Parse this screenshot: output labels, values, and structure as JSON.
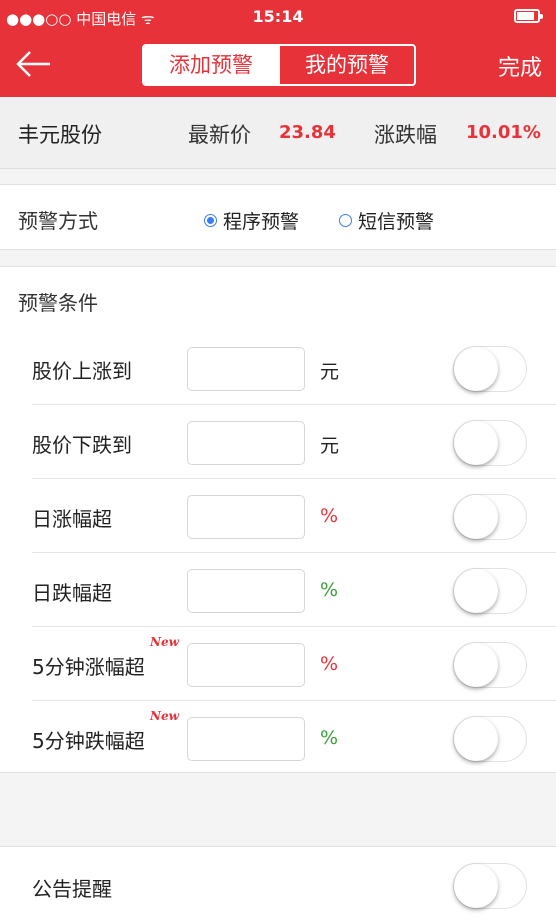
{
  "status_bar": {
    "carrier": "●●●○○ 中国电信 ᯤ",
    "time": "15:14",
    "battery_level": 0.85
  },
  "nav": {
    "back_icon": "arrow-left-icon",
    "tabs": [
      {
        "label": "添加预警",
        "active": true
      },
      {
        "label": "我的预警",
        "active": false
      }
    ],
    "done_label": "完成"
  },
  "stock": {
    "name": "丰元股份",
    "price_label": "最新价",
    "price_value": "23.84",
    "change_label": "涨跌幅",
    "change_value": "10.01%"
  },
  "alert_mode": {
    "title": "预警方式",
    "options": [
      {
        "label": "程序预警",
        "selected": true
      },
      {
        "label": "短信预警",
        "selected": false
      }
    ]
  },
  "conditions": {
    "title": "预警条件",
    "rows": [
      {
        "label": "股价上涨到",
        "unit": "元",
        "value": "",
        "tag": "",
        "enabled": false
      },
      {
        "label": "股价下跌到",
        "unit": "元",
        "value": "",
        "tag": "",
        "enabled": false
      },
      {
        "label": "日涨幅超",
        "unit": "%",
        "value": "",
        "tag": "",
        "enabled": false
      },
      {
        "label": "日跌幅超",
        "unit": "%",
        "value": "",
        "tag": "",
        "enabled": false
      },
      {
        "label": "5分钟涨幅超",
        "unit": "%",
        "value": "",
        "tag": "New",
        "enabled": false
      },
      {
        "label": "5分钟跌幅超",
        "unit": "%",
        "value": "",
        "tag": "New",
        "enabled": false
      }
    ]
  },
  "notice": {
    "title": "公告提醒",
    "enabled": false
  },
  "colors": {
    "brand_red": "#e8323a",
    "radio_blue": "#3a7df0",
    "down_green": "#3aa03a"
  }
}
